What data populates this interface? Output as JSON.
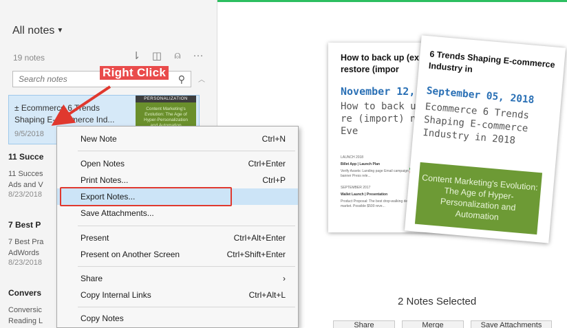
{
  "sidebar": {
    "title": "All notes",
    "note_count": "19 notes",
    "search": {
      "placeholder": "Search notes"
    },
    "notes": [
      {
        "title": "± Ecommerce 6 Trends Shaping E-commerce Ind...",
        "snippet_line1": "± Ecommerce 6 Trends",
        "snippet_line2": "Shaping E-commerce Ind...",
        "date": "9/5/2018",
        "thumb_band": "PERSONALIZATION",
        "thumb_text": "Content Marketing's Evolution: The Age of Hyper-Personalization and Automation"
      },
      {
        "title": "11 Succe",
        "snippet_line1": "11 Succes",
        "snippet_line2": "Ads and V",
        "date": "8/23/2018"
      },
      {
        "title": "7 Best P",
        "snippet_line1": "7 Best Pra",
        "snippet_line2": "AdWords",
        "date": "8/23/2018"
      },
      {
        "title": "Convers",
        "snippet_line1": "Conversic",
        "snippet_line2": "Reading L",
        "date": ""
      }
    ]
  },
  "annotation": {
    "label": "Right Click"
  },
  "context_menu": {
    "items": [
      {
        "label": "New Note",
        "shortcut": "Ctrl+N"
      },
      {
        "label": "Open Notes",
        "shortcut": "Ctrl+Enter"
      },
      {
        "label": "Print Notes...",
        "shortcut": "Ctrl+P"
      },
      {
        "label": "Export Notes...",
        "shortcut": ""
      },
      {
        "label": "Save Attachments...",
        "shortcut": ""
      },
      {
        "label": "Present",
        "shortcut": "Ctrl+Alt+Enter"
      },
      {
        "label": "Present on Another Screen",
        "shortcut": "Ctrl+Shift+Enter"
      },
      {
        "label": "Share",
        "shortcut": "›"
      },
      {
        "label": "Copy Internal Links",
        "shortcut": "Ctrl+Alt+L"
      },
      {
        "label": "Copy Notes",
        "shortcut": ""
      }
    ],
    "highlighted": "Export Notes..."
  },
  "preview": {
    "card1": {
      "title": "How to back up (ex and restore (impor",
      "date": "November 12, 2",
      "body": "How to back up (export) and re (import) notes notebooks Eve",
      "mini1": "LAUNCH 2018",
      "mini2": "Billet App | Launch Plan",
      "mini3": "Verify Assets: Landing page Email campaign Homepage banner Press rele...",
      "mini4": "SEPTEMBER 2017",
      "mini5": "Wallet Launch | Presentation",
      "mini6": "Product Proposal: The best drop-walking deal on the market. Possible $500 reve..."
    },
    "card2": {
      "title": "6 Trends Shaping E-commerce Industry in",
      "date": "September 05, 2018",
      "body": "Ecommerce 6 Trends Shaping E-commerce Industry in 2018",
      "image_text": "Content Marketing's Evolution: The Age of Hyper-Personalization and Automation"
    },
    "selected_label": "2 Notes Selected",
    "buttons": [
      "Share",
      "Merge",
      "Save Attachments"
    ]
  },
  "colors": {
    "accent_green": "#2dbe60",
    "highlight_red": "#e0382e",
    "menu_highlight": "#cce4f7",
    "date_blue": "#2a70b5"
  }
}
